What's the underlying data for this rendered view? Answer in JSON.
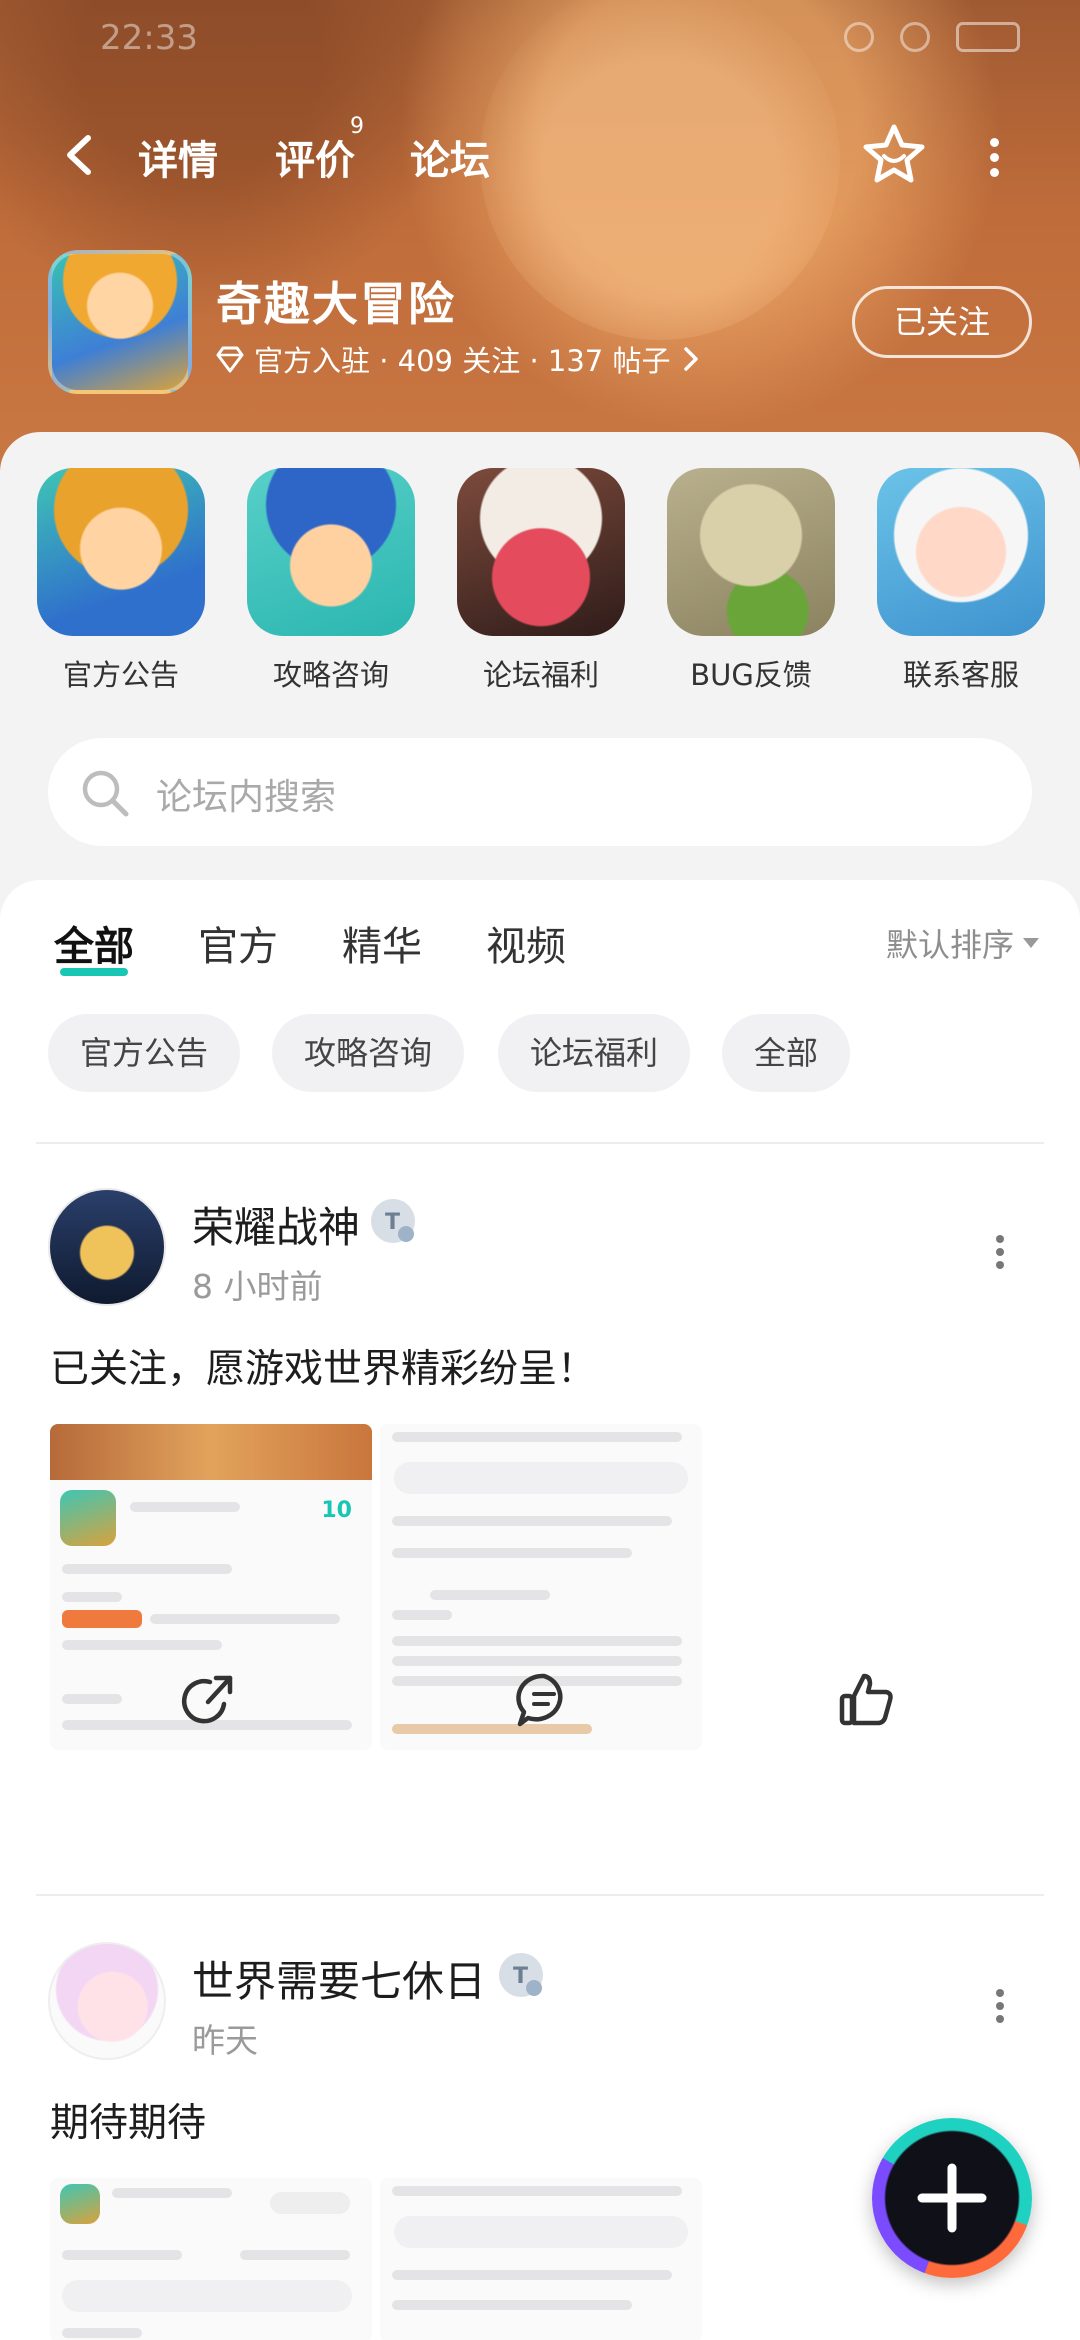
{
  "status_bar": {
    "time": "22:33"
  },
  "nav": {
    "tabs": [
      {
        "label": "详情"
      },
      {
        "label": "评价"
      },
      {
        "label": "论坛"
      }
    ],
    "review_badge": "9",
    "active_tab": "论坛"
  },
  "app": {
    "name": "奇趣大冒险",
    "meta": "官方入驻 · 409 关注 · 137 帖子",
    "follow_label": "已关注"
  },
  "categories": [
    {
      "label": "官方公告"
    },
    {
      "label": "攻略咨询"
    },
    {
      "label": "论坛福利"
    },
    {
      "label": "BUG反馈"
    },
    {
      "label": "联系客服"
    }
  ],
  "search": {
    "placeholder": "论坛内搜索"
  },
  "feed_tabs": [
    {
      "label": "全部"
    },
    {
      "label": "官方"
    },
    {
      "label": "精华"
    },
    {
      "label": "视频"
    }
  ],
  "sort_label": "默认排序",
  "chips": [
    {
      "label": "官方公告"
    },
    {
      "label": "攻略咨询"
    },
    {
      "label": "论坛福利"
    },
    {
      "label": "全部"
    }
  ],
  "posts": [
    {
      "author": "荣耀战神",
      "time": "8 小时前",
      "text": "已关注，愿游戏世界精彩纷呈！"
    },
    {
      "author": "世界需要七休日",
      "time": "昨天",
      "text": "期待期待"
    }
  ],
  "colors": {
    "accent": "#17c7b4",
    "banner": "#bf6c3a"
  }
}
